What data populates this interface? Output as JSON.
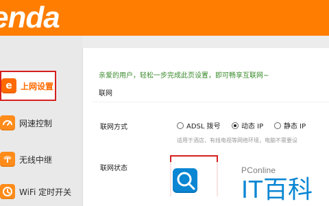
{
  "header": {
    "brand": "enda"
  },
  "sidebar": {
    "items": [
      {
        "label": "上网设置",
        "icon": "e-icon"
      },
      {
        "label": "网速控制",
        "icon": "speedometer-icon"
      },
      {
        "label": "无线中继",
        "icon": "wireless-relay-icon"
      },
      {
        "label": "WiFi 定时开关",
        "icon": "clock-icon"
      }
    ]
  },
  "main": {
    "welcome": "亲爱的用户，轻松一步完成此页设置，即可畅享互联网~",
    "section_title": "联网",
    "form": {
      "connection_method_label": "联网方式",
      "options": [
        {
          "label": "ADSL 拨号",
          "selected": false
        },
        {
          "label": "动态 IP",
          "selected": true
        },
        {
          "label": "静态 IP",
          "selected": false
        }
      ],
      "hint": "适用于酒店、有线电视等网络环境，电脑不需要设",
      "status_label": "联网状态"
    }
  },
  "watermark": {
    "small": "PConline",
    "big": "IT百科"
  }
}
